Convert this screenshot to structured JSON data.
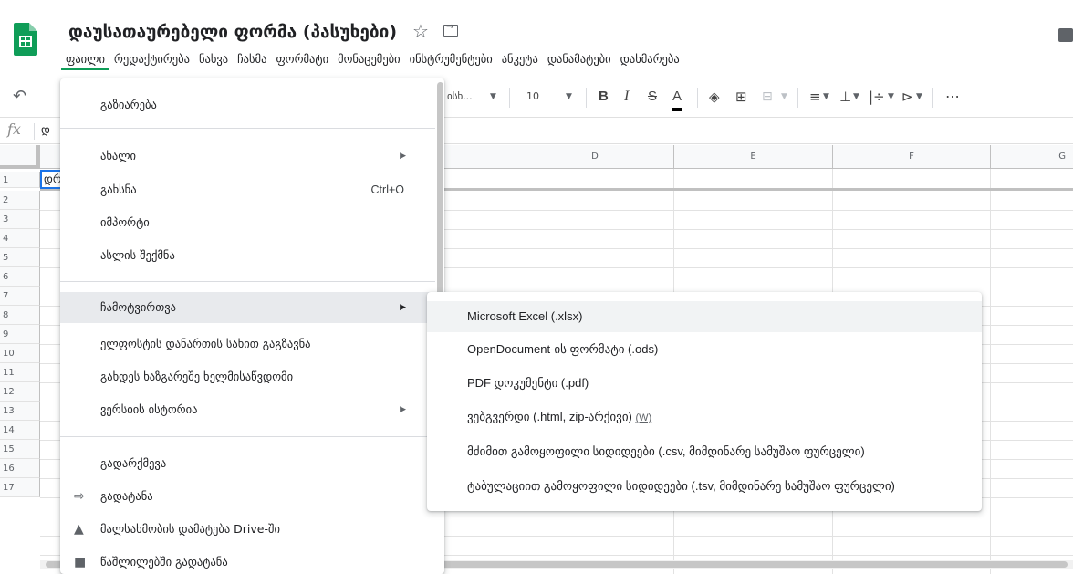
{
  "app": {
    "doc_title": "დაუსათაურებელი ფორმა (პასუხები)",
    "brand_color": "#0f9d58",
    "accent_color": "#1a73e8",
    "header_icons": [
      "star-icon",
      "move-to-folder-icon",
      "comments-icon"
    ]
  },
  "menubar": {
    "items": [
      {
        "label": "ფაილი",
        "active": true
      },
      {
        "label": "რედაქტირება"
      },
      {
        "label": "ნახვა"
      },
      {
        "label": "ჩასმა"
      },
      {
        "label": "ფორმატი"
      },
      {
        "label": "მონაცემები"
      },
      {
        "label": "ინსტრუმენტები"
      },
      {
        "label": "ანკეტა"
      },
      {
        "label": "დანამატები"
      },
      {
        "label": "დახმარება"
      }
    ]
  },
  "toolbar": {
    "font_name": "ისხ...",
    "font_size": "10",
    "bold": "B",
    "italic": "I",
    "strikethrough": "S",
    "text_color": "A",
    "more": "⋯"
  },
  "formula_bar": {
    "fx_label": "fx",
    "value": "დ"
  },
  "grid": {
    "columns": [
      "D",
      "E",
      "F",
      "G"
    ],
    "rows": [
      "1",
      "2",
      "3",
      "4",
      "5",
      "6",
      "7",
      "8",
      "9",
      "10",
      "11",
      "12",
      "13",
      "14",
      "15",
      "16",
      "17"
    ],
    "a1_value": "დრ"
  },
  "file_menu": {
    "items": [
      {
        "label": "გაზიარება"
      },
      {
        "label": "ახალი",
        "submenu": true
      },
      {
        "label": "გახსნა",
        "shortcut": "Ctrl+O"
      },
      {
        "label": "იმპორტი"
      },
      {
        "label": "ასლის შექმნა"
      },
      {
        "label": "ჩამოტვირთვა",
        "submenu": true,
        "active": true
      },
      {
        "label": "ელფოსტის დანართის სახით გაგზავნა"
      },
      {
        "label": "გახდეს ხაზგარეშე ხელმისაწვდომი"
      },
      {
        "label": "ვერსიის ისტორია",
        "submenu": true
      },
      {
        "label": "გადარქმევა"
      },
      {
        "label": "გადატანა",
        "icon": "move-icon"
      },
      {
        "label": "მალსახმობის დამატება Drive-ში",
        "icon": "drive-icon"
      },
      {
        "label": "წაშლილებში გადატანა",
        "icon": "trash-icon"
      }
    ]
  },
  "download_submenu": {
    "items": [
      {
        "label": "Microsoft Excel (.xlsx)"
      },
      {
        "label": "OpenDocument-ის ფორმატი (.ods)"
      },
      {
        "label": "PDF დოკუმენტი (.pdf)"
      },
      {
        "label": "ვებგვერდი (.html, zip-არქივი)",
        "note": "(W)"
      },
      {
        "label": "მძიმით გამოყოფილი სიდიდეები (.csv, მიმდინარე სამუშაო ფურცელი)"
      },
      {
        "label": "ტაბულაციით გამოყოფილი სიდიდეები (.tsv, მიმდინარე სამუშაო ფურცელი)"
      }
    ]
  }
}
